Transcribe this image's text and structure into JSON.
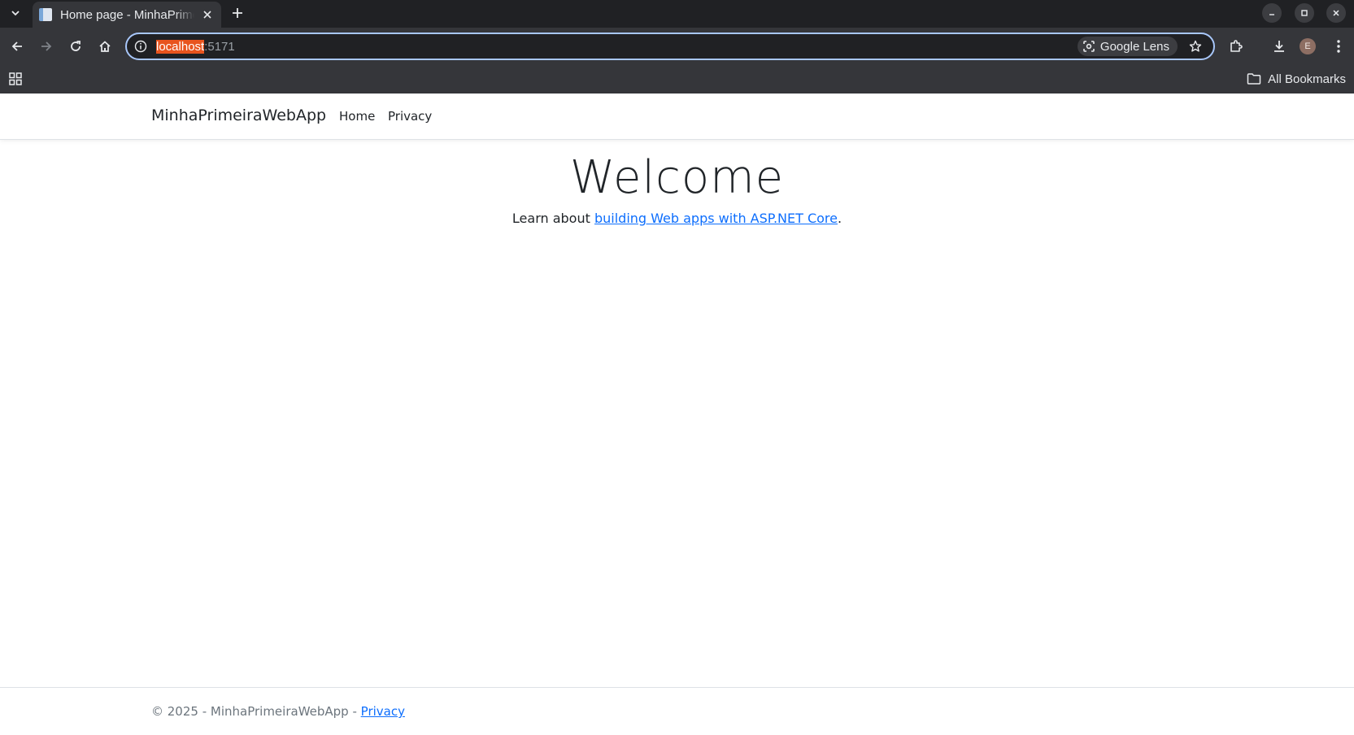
{
  "browser": {
    "tab_title": "Home page - MinhaPrimeiraWebApp",
    "url_host": "localhost",
    "url_rest": ":5171",
    "lens_label": "Google Lens",
    "all_bookmarks_label": "All Bookmarks",
    "profile_initial": "E",
    "profile_color": "#8d6e63"
  },
  "navbar": {
    "brand": "MinhaPrimeiraWebApp",
    "links": [
      "Home",
      "Privacy"
    ]
  },
  "main": {
    "heading": "Welcome",
    "lead_prefix": "Learn about ",
    "lead_link": "building Web apps with ASP.NET Core",
    "lead_suffix": "."
  },
  "footer": {
    "text": "© 2025 - MinhaPrimeiraWebApp - ",
    "link": "Privacy"
  },
  "colors": {
    "link": "#0d6efd",
    "url_highlight": "#e8541e",
    "omnibox_border": "#a8c7fa"
  }
}
